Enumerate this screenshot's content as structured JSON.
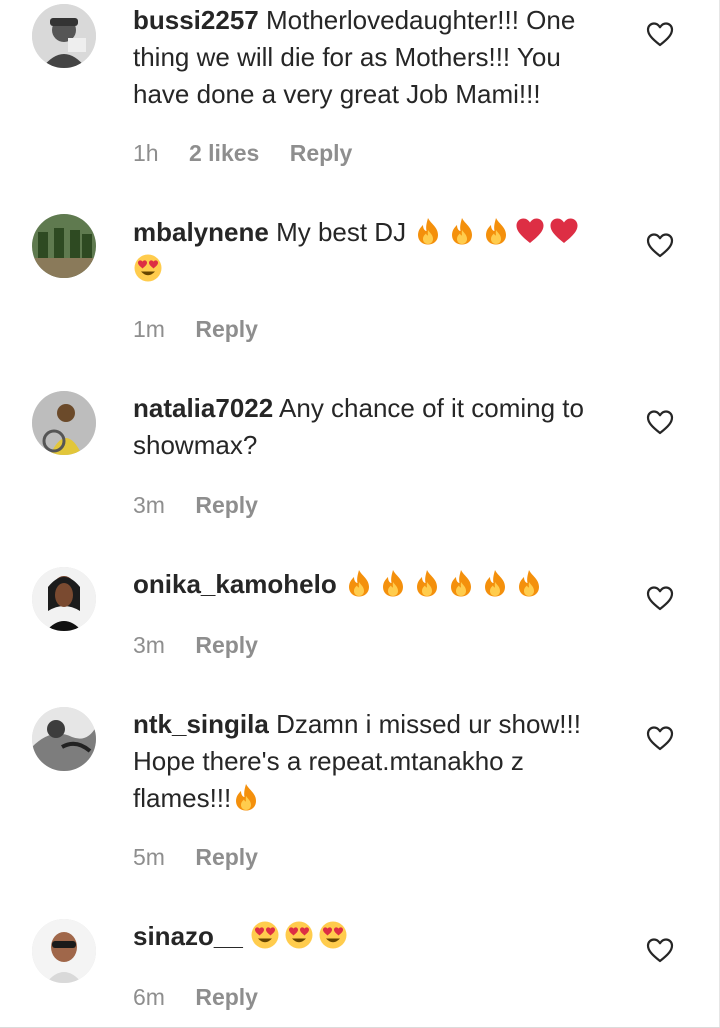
{
  "comments": [
    {
      "username": "bussi2257",
      "text": "Motherlovedaughter!!! One thing we will die for as Mothers!!! You have done a very great Job Mami!!!",
      "emojis": [],
      "time": "1h",
      "likes": "2 likes",
      "reply": "Reply",
      "avatar_color": "#cfcfcf"
    },
    {
      "username": "mbalynene",
      "text": "My best DJ",
      "emojis": [
        "fire",
        "fire",
        "fire",
        "red-heart",
        "red-heart",
        "heart-eyes"
      ],
      "time": "1m",
      "likes": "",
      "reply": "Reply",
      "avatar_color": "#4a6b3a"
    },
    {
      "username": "natalia7022",
      "text": "Any chance of it coming to showmax?",
      "emojis": [],
      "time": "3m",
      "likes": "",
      "reply": "Reply",
      "avatar_color": "#c9b26a"
    },
    {
      "username": "onika_kamohelo",
      "text": "",
      "emojis": [
        "fire",
        "fire",
        "fire",
        "fire",
        "fire",
        "fire"
      ],
      "time": "3m",
      "likes": "",
      "reply": "Reply",
      "avatar_color": "#6b4a3a"
    },
    {
      "username": "ntk_singila",
      "text": "Dzamn i missed ur show!!! Hope there's a repeat.mtanakho z flames!!!",
      "emojis": [
        "fire"
      ],
      "time": "5m",
      "likes": "",
      "reply": "Reply",
      "avatar_color": "#9a9a9a"
    },
    {
      "username": "sinazo__",
      "text": "",
      "emojis": [
        "heart-eyes",
        "heart-eyes",
        "heart-eyes"
      ],
      "time": "6m",
      "likes": "",
      "reply": "Reply",
      "avatar_color": "#b88a6a"
    }
  ],
  "colors": {
    "text": "#262626",
    "meta": "#8e8e8e",
    "fire_outer": "#f4900c",
    "fire_inner": "#ffcc4d",
    "heart_red": "#dd2e44",
    "emoji_face": "#ffcc4d"
  },
  "icons": {
    "like": "heart-outline-icon"
  }
}
